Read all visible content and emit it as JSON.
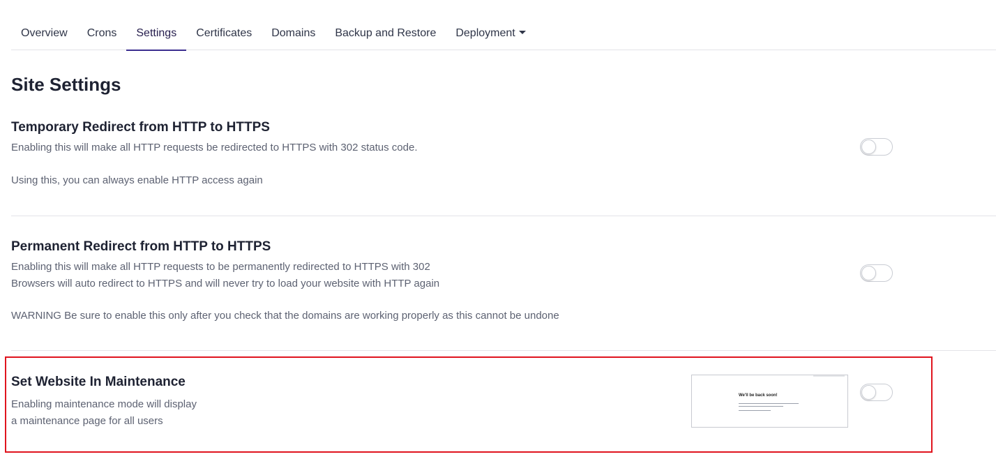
{
  "tabs": [
    {
      "label": "Overview"
    },
    {
      "label": "Crons"
    },
    {
      "label": "Settings",
      "active": true
    },
    {
      "label": "Certificates"
    },
    {
      "label": "Domains"
    },
    {
      "label": "Backup and Restore"
    },
    {
      "label": "Deployment",
      "has_dropdown": true
    }
  ],
  "page_title": "Site Settings",
  "settings": {
    "temporary_redirect": {
      "title": "Temporary Redirect from HTTP to HTTPS",
      "desc_line1": "Enabling this will make all HTTP requests be redirected to HTTPS with 302 status code.",
      "desc_line2": "Using this, you can always enable HTTP access again",
      "enabled": false
    },
    "permanent_redirect": {
      "title": "Permanent Redirect from HTTP to HTTPS",
      "desc_line1": "Enabling this will make all HTTP requests to be permanently redirected to HTTPS with 302",
      "desc_line2": "Browsers will auto redirect to HTTPS and will never try to load your website with HTTP again",
      "desc_line3": "WARNING Be sure to enable this only after you check that the domains are working properly as this cannot be undone",
      "enabled": false
    },
    "maintenance": {
      "title": "Set Website In Maintenance",
      "desc_line1": "Enabling maintenance mode will display",
      "desc_line2": "a maintenance page for all users",
      "preview_title": "We'll be back soon!",
      "enabled": false
    }
  },
  "colors": {
    "accent": "#3b2d8f",
    "highlight_border": "#e0141e"
  },
  "icons": {
    "dropdown_caret": "caret-down-icon"
  }
}
